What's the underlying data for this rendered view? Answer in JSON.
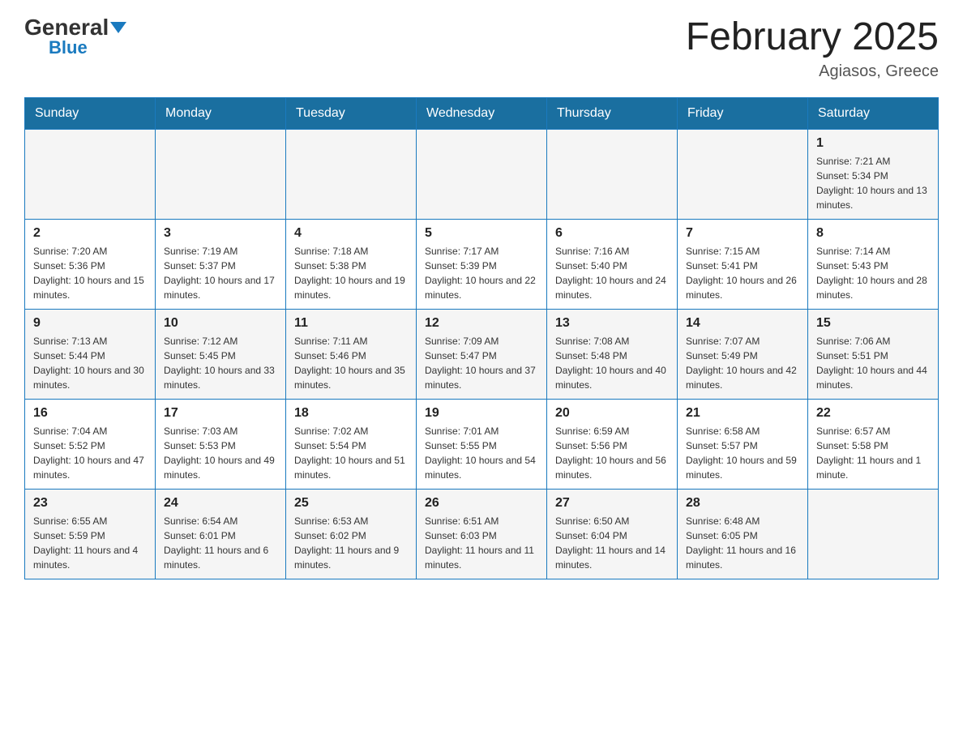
{
  "header": {
    "logo_general": "General",
    "logo_blue": "Blue",
    "month_title": "February 2025",
    "location": "Agiasos, Greece"
  },
  "weekdays": [
    "Sunday",
    "Monday",
    "Tuesday",
    "Wednesday",
    "Thursday",
    "Friday",
    "Saturday"
  ],
  "weeks": [
    [
      {
        "day": "",
        "info": ""
      },
      {
        "day": "",
        "info": ""
      },
      {
        "day": "",
        "info": ""
      },
      {
        "day": "",
        "info": ""
      },
      {
        "day": "",
        "info": ""
      },
      {
        "day": "",
        "info": ""
      },
      {
        "day": "1",
        "info": "Sunrise: 7:21 AM\nSunset: 5:34 PM\nDaylight: 10 hours and 13 minutes."
      }
    ],
    [
      {
        "day": "2",
        "info": "Sunrise: 7:20 AM\nSunset: 5:36 PM\nDaylight: 10 hours and 15 minutes."
      },
      {
        "day": "3",
        "info": "Sunrise: 7:19 AM\nSunset: 5:37 PM\nDaylight: 10 hours and 17 minutes."
      },
      {
        "day": "4",
        "info": "Sunrise: 7:18 AM\nSunset: 5:38 PM\nDaylight: 10 hours and 19 minutes."
      },
      {
        "day": "5",
        "info": "Sunrise: 7:17 AM\nSunset: 5:39 PM\nDaylight: 10 hours and 22 minutes."
      },
      {
        "day": "6",
        "info": "Sunrise: 7:16 AM\nSunset: 5:40 PM\nDaylight: 10 hours and 24 minutes."
      },
      {
        "day": "7",
        "info": "Sunrise: 7:15 AM\nSunset: 5:41 PM\nDaylight: 10 hours and 26 minutes."
      },
      {
        "day": "8",
        "info": "Sunrise: 7:14 AM\nSunset: 5:43 PM\nDaylight: 10 hours and 28 minutes."
      }
    ],
    [
      {
        "day": "9",
        "info": "Sunrise: 7:13 AM\nSunset: 5:44 PM\nDaylight: 10 hours and 30 minutes."
      },
      {
        "day": "10",
        "info": "Sunrise: 7:12 AM\nSunset: 5:45 PM\nDaylight: 10 hours and 33 minutes."
      },
      {
        "day": "11",
        "info": "Sunrise: 7:11 AM\nSunset: 5:46 PM\nDaylight: 10 hours and 35 minutes."
      },
      {
        "day": "12",
        "info": "Sunrise: 7:09 AM\nSunset: 5:47 PM\nDaylight: 10 hours and 37 minutes."
      },
      {
        "day": "13",
        "info": "Sunrise: 7:08 AM\nSunset: 5:48 PM\nDaylight: 10 hours and 40 minutes."
      },
      {
        "day": "14",
        "info": "Sunrise: 7:07 AM\nSunset: 5:49 PM\nDaylight: 10 hours and 42 minutes."
      },
      {
        "day": "15",
        "info": "Sunrise: 7:06 AM\nSunset: 5:51 PM\nDaylight: 10 hours and 44 minutes."
      }
    ],
    [
      {
        "day": "16",
        "info": "Sunrise: 7:04 AM\nSunset: 5:52 PM\nDaylight: 10 hours and 47 minutes."
      },
      {
        "day": "17",
        "info": "Sunrise: 7:03 AM\nSunset: 5:53 PM\nDaylight: 10 hours and 49 minutes."
      },
      {
        "day": "18",
        "info": "Sunrise: 7:02 AM\nSunset: 5:54 PM\nDaylight: 10 hours and 51 minutes."
      },
      {
        "day": "19",
        "info": "Sunrise: 7:01 AM\nSunset: 5:55 PM\nDaylight: 10 hours and 54 minutes."
      },
      {
        "day": "20",
        "info": "Sunrise: 6:59 AM\nSunset: 5:56 PM\nDaylight: 10 hours and 56 minutes."
      },
      {
        "day": "21",
        "info": "Sunrise: 6:58 AM\nSunset: 5:57 PM\nDaylight: 10 hours and 59 minutes."
      },
      {
        "day": "22",
        "info": "Sunrise: 6:57 AM\nSunset: 5:58 PM\nDaylight: 11 hours and 1 minute."
      }
    ],
    [
      {
        "day": "23",
        "info": "Sunrise: 6:55 AM\nSunset: 5:59 PM\nDaylight: 11 hours and 4 minutes."
      },
      {
        "day": "24",
        "info": "Sunrise: 6:54 AM\nSunset: 6:01 PM\nDaylight: 11 hours and 6 minutes."
      },
      {
        "day": "25",
        "info": "Sunrise: 6:53 AM\nSunset: 6:02 PM\nDaylight: 11 hours and 9 minutes."
      },
      {
        "day": "26",
        "info": "Sunrise: 6:51 AM\nSunset: 6:03 PM\nDaylight: 11 hours and 11 minutes."
      },
      {
        "day": "27",
        "info": "Sunrise: 6:50 AM\nSunset: 6:04 PM\nDaylight: 11 hours and 14 minutes."
      },
      {
        "day": "28",
        "info": "Sunrise: 6:48 AM\nSunset: 6:05 PM\nDaylight: 11 hours and 16 minutes."
      },
      {
        "day": "",
        "info": ""
      }
    ]
  ]
}
